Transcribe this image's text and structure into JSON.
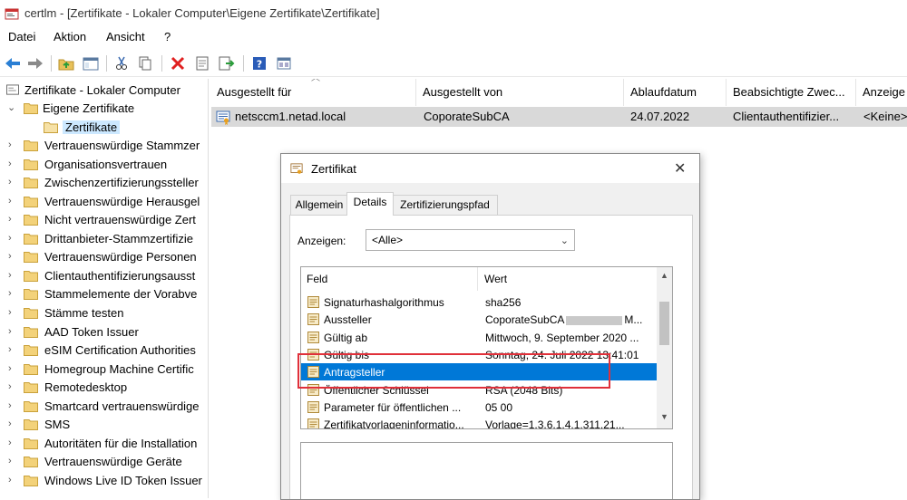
{
  "window": {
    "title": "certlm - [Zertifikate - Lokaler Computer\\Eigene Zertifikate\\Zertifikate]"
  },
  "menu": [
    "Datei",
    "Aktion",
    "Ansicht",
    "?"
  ],
  "toolbar": {
    "icons": [
      "back-arrow-icon",
      "forward-arrow-icon",
      "up-folder-icon",
      "show-hide-tree-icon",
      "cut-icon",
      "copy-icon",
      "delete-icon",
      "properties-icon",
      "export-icon",
      "help-icon",
      "mmc-view-icon"
    ]
  },
  "tree": {
    "root": "Zertifikate - Lokaler Computer",
    "open_folder": "Eigene Zertifikate",
    "selected_child": "Zertifikate",
    "folders": [
      "Vertrauenswürdige Stammzer",
      "Organisationsvertrauen",
      "Zwischenzertifizierungssteller",
      "Vertrauenswürdige Herausgel",
      "Nicht vertrauenswürdige Zert",
      "Drittanbieter-Stammzertifizie",
      "Vertrauenswürdige Personen",
      "Clientauthentifizierungsausst",
      "Stammelemente der Vorabve",
      "Stämme testen",
      "AAD Token Issuer",
      "eSIM Certification Authorities",
      "Homegroup Machine Certific",
      "Remotedesktop",
      "Smartcard vertrauenswürdige",
      "SMS",
      "Autoritäten für die Installation",
      "Vertrauenswürdige Geräte",
      "Windows Live ID Token Issuer"
    ]
  },
  "list": {
    "columns": [
      "Ausgestellt für",
      "Ausgestellt von",
      "Ablaufdatum",
      "Beabsichtigte Zwec...",
      "Anzeige"
    ],
    "rows": [
      {
        "issued_to": "netsccm1.netad.local",
        "issued_by": "CoporateSubCA",
        "expires": "24.07.2022",
        "purpose": "Clientauthentifizier...",
        "display": "<Keine>"
      }
    ]
  },
  "dialog": {
    "title": "Zertifikat",
    "close": "✕",
    "tabs": [
      "Allgemein",
      "Details",
      "Zertifizierungspfad"
    ],
    "active_tab": "Details",
    "show_label": "Anzeigen:",
    "show_value": "<Alle>",
    "field_header": "Feld",
    "value_header": "Wert",
    "fields": [
      {
        "key": "Signaturhashalgorithmus",
        "value": "sha256"
      },
      {
        "key": "Aussteller",
        "value": "CoporateSubCA",
        "value_suffix": "M..."
      },
      {
        "key": "Gültig ab",
        "value": "Mittwoch, 9. September 2020 ..."
      },
      {
        "key": "Gültig bis",
        "value": "Sonntag, 24. Juli 2022 13:41:01"
      },
      {
        "key": "Antragsteller",
        "value": ""
      },
      {
        "key": "Öffentlicher Schlüssel",
        "value": "RSA (2048 Bits)"
      },
      {
        "key": "Parameter für öffentlichen ...",
        "value": "05 00"
      },
      {
        "key": "Zertifikatvorlageninformatio...",
        "value": "Vorlage=1.3.6.1.4.1.311.21..."
      }
    ],
    "selected_field": "Antragsteller"
  },
  "colors": {
    "selection": "#0078d7",
    "annotation": "#e0303a",
    "tree_selection": "#cce8ff"
  }
}
